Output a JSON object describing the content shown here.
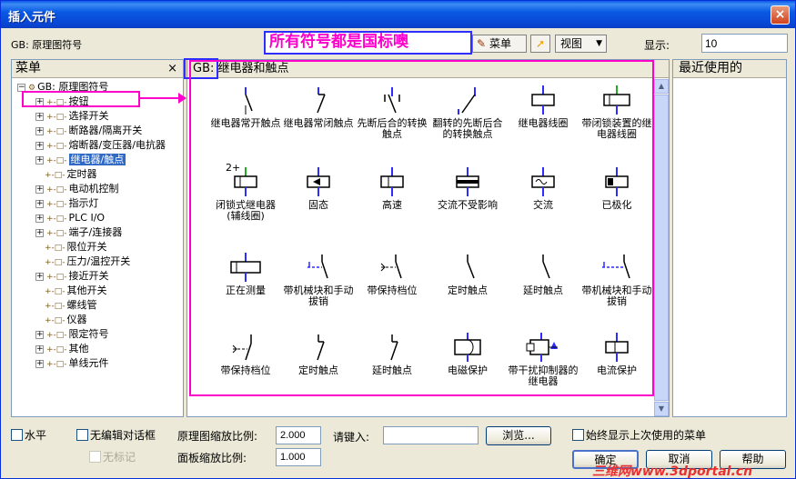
{
  "window": {
    "title": "插入元件",
    "close_glyph": "×"
  },
  "top": {
    "gb_label": "GB: 原理图符号",
    "annotation": "所有符号都是国标噢",
    "menu_button": "菜单",
    "view_button": "视图",
    "show_label": "显示:",
    "show_value": "10"
  },
  "left": {
    "header": "菜单",
    "close_glyph": "×",
    "root": "GB: 原理图符号",
    "items": [
      {
        "label": "按钮",
        "expand": true
      },
      {
        "label": "选择开关",
        "expand": true
      },
      {
        "label": "断路器/隔离开关",
        "expand": true
      },
      {
        "label": "熔断器/变压器/电抗器",
        "expand": true
      },
      {
        "label": "继电器/触点",
        "expand": true,
        "selected": true
      },
      {
        "label": "定时器",
        "expand": false
      },
      {
        "label": "电动机控制",
        "expand": true
      },
      {
        "label": "指示灯",
        "expand": true
      },
      {
        "label": "PLC I/O",
        "expand": true
      },
      {
        "label": "端子/连接器",
        "expand": true
      },
      {
        "label": "限位开关",
        "expand": false
      },
      {
        "label": "压力/温控开关",
        "expand": false
      },
      {
        "label": "接近开关",
        "expand": true
      },
      {
        "label": "其他开关",
        "expand": false
      },
      {
        "label": "螺线管",
        "expand": false
      },
      {
        "label": "仪器",
        "expand": false
      },
      {
        "label": "限定符号",
        "expand": true
      },
      {
        "label": "其他",
        "expand": true
      },
      {
        "label": "单线元件",
        "expand": true
      }
    ]
  },
  "middle": {
    "header": "GB: 继电器和触点",
    "symbols": [
      {
        "label": "继电器常开触点",
        "icon": "no-contact-icon"
      },
      {
        "label": "继电器常闭触点",
        "icon": "nc-contact-icon"
      },
      {
        "label": "先断后合的转换触点",
        "icon": "break-before-make-icon"
      },
      {
        "label": "翻转的先断后合的转换触点",
        "icon": "reversed-changeover-icon"
      },
      {
        "label": "继电器线圈",
        "icon": "relay-coil-icon"
      },
      {
        "label": "带闭锁装置的继电器线圈",
        "icon": "latching-coil-icon"
      },
      {
        "label": "闭锁式继电器(辅线圈)",
        "icon": "latch-aux-coil-icon",
        "badge": "2+"
      },
      {
        "label": "固态",
        "icon": "solid-state-icon"
      },
      {
        "label": "高速",
        "icon": "high-speed-icon"
      },
      {
        "label": "交流不受影响",
        "icon": "ac-immune-icon"
      },
      {
        "label": "交流",
        "icon": "ac-coil-icon"
      },
      {
        "label": "已极化",
        "icon": "polarized-icon"
      },
      {
        "label": "正在测量",
        "icon": "measuring-icon"
      },
      {
        "label": "带机械块和手动拔销",
        "icon": "mech-block-icon"
      },
      {
        "label": "带保持档位",
        "icon": "hold-position-icon"
      },
      {
        "label": "定时触点",
        "icon": "timed-contact-icon"
      },
      {
        "label": "延时触点",
        "icon": "delay-contact-icon"
      },
      {
        "label": "带机械块和手动拔销",
        "icon": "mech-block-pin-icon"
      },
      {
        "label": "带保持档位",
        "icon": "hold-position-2-icon"
      },
      {
        "label": "定时触点",
        "icon": "timed-contact-2-icon"
      },
      {
        "label": "延时触点",
        "icon": "delay-contact-2-icon"
      },
      {
        "label": "电磁保护",
        "icon": "em-protection-icon"
      },
      {
        "label": "带干扰抑制器的继电器",
        "icon": "suppressor-relay-icon"
      },
      {
        "label": "电流保护",
        "icon": "current-protection-icon"
      }
    ]
  },
  "right": {
    "header": "最近使用的"
  },
  "bottom": {
    "horizontal": "水平",
    "no_edit_dialog": "无编辑对话框",
    "no_mark": "无标记",
    "scale_label": "原理图缩放比例:",
    "scale_value": "2.000",
    "panel_scale_label": "面板缩放比例:",
    "panel_scale_value": "1.000",
    "input_label": "请键入:",
    "input_value": "",
    "browse": "浏览...",
    "always_show": "始终显示上次使用的菜单",
    "ok": "确定",
    "cancel": "取消",
    "help": "帮助"
  },
  "watermark": "三维网www.3dportal.cn",
  "colors": {
    "accent_pink": "#ff00cc",
    "accent_blue": "#2d2dff",
    "title_blue": "#0a58e8"
  }
}
